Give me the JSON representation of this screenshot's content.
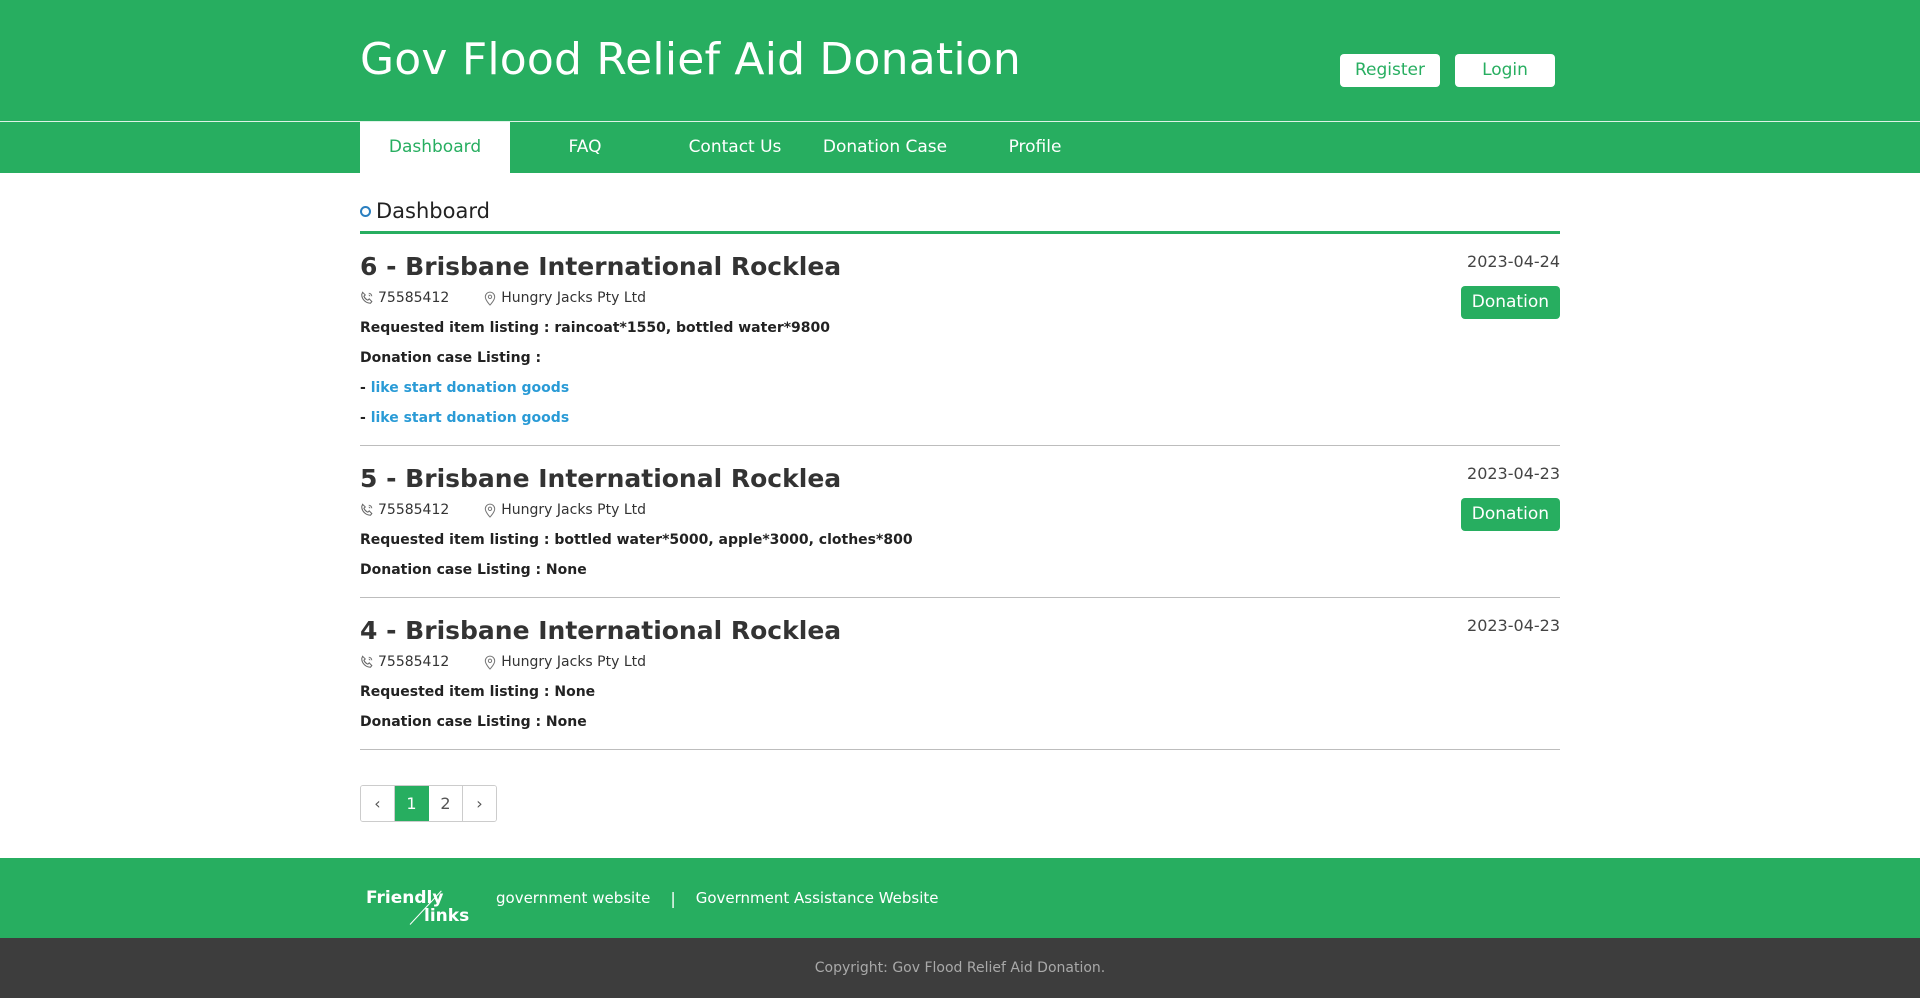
{
  "header": {
    "title": "Gov Flood Relief Aid Donation",
    "register_label": "Register",
    "login_label": "Login"
  },
  "nav": {
    "items": [
      {
        "label": "Dashboard"
      },
      {
        "label": "FAQ"
      },
      {
        "label": "Contact Us"
      },
      {
        "label": "Donation Case"
      },
      {
        "label": "Profile"
      }
    ],
    "active": "Dashboard"
  },
  "main": {
    "section_title": "Dashboard",
    "cases": [
      {
        "title": "6 - Brisbane International Rocklea",
        "date": "2023-04-24",
        "phone": "75585412",
        "location": "Hungry Jacks Pty Ltd",
        "requested": "Requested item listing : raincoat*1550, bottled water*9800",
        "donation_listing": "Donation case Listing :",
        "links": [
          "like start donation goods",
          "like start donation goods"
        ],
        "link_prefix": "- ",
        "button": "Donation"
      },
      {
        "title": "5 - Brisbane International Rocklea",
        "date": "2023-04-23",
        "phone": "75585412",
        "location": "Hungry Jacks Pty Ltd",
        "requested": "Requested item listing : bottled water*5000, apple*3000, clothes*800",
        "donation_listing": "Donation case Listing : None",
        "button": "Donation"
      },
      {
        "title": "4 - Brisbane International Rocklea",
        "date": "2023-04-23",
        "phone": "75585412",
        "location": "Hungry Jacks Pty Ltd",
        "requested": "Requested item listing : None",
        "donation_listing": "Donation case Listing : None"
      }
    ],
    "pagination": {
      "prev": "‹",
      "pages": [
        "1",
        "2"
      ],
      "current": "1",
      "next": "›"
    }
  },
  "footer": {
    "friendly_a": "Friendly",
    "friendly_b": "links",
    "link1": "government website",
    "separator": "|",
    "link2": "Government Assistance Website",
    "copyright": "Copyright: Gov Flood Relief Aid Donation."
  },
  "colors": {
    "brand_green": "#27ae60",
    "link_blue": "#2a9bd6",
    "footer_dark": "#3d3d3d"
  }
}
